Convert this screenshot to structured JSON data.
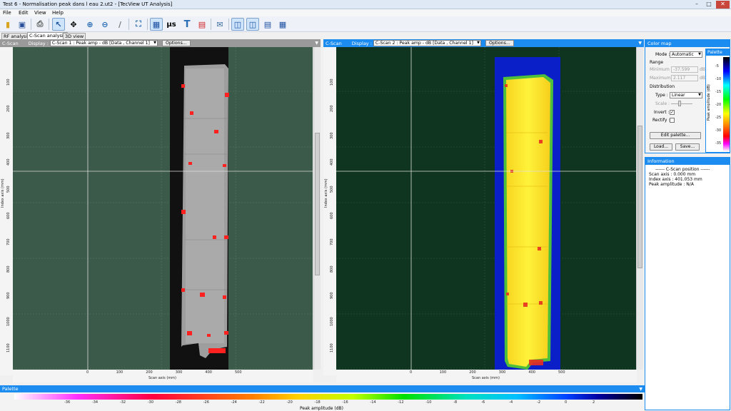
{
  "window": {
    "title": "Test 6 - Normalisation peak dans l eau 2.ut2 - [TecView UT Analysis]"
  },
  "menu": [
    "File",
    "Edit",
    "View",
    "Help"
  ],
  "toolbar": {
    "us_label": "µs",
    "t_label": "T"
  },
  "tabs": [
    "RF analysis",
    "C-Scan analysis",
    "3D view"
  ],
  "left_pane": {
    "label": "C-Scan",
    "display_label": "Display :",
    "display_value": "C-Scan 1 : Peak amp - dB [Data , Channel 1]",
    "options": "Options...",
    "y_axis_label": "Index axis (mm)",
    "x_axis_label": "Scan axis (mm)",
    "y_ticks": [
      "100",
      "200",
      "300",
      "400",
      "500",
      "600",
      "700",
      "800",
      "900",
      "1000",
      "1100"
    ],
    "x_ticks": [
      "0",
      "100",
      "200",
      "300",
      "400",
      "500"
    ]
  },
  "right_pane": {
    "label": "C-Scan",
    "display_label": "Display :",
    "display_value": "C-Scan 2 : Peak amp - dB [Data , Channel 1]",
    "options": "Options...",
    "y_axis_label": "Index axis (mm)",
    "x_axis_label": "Scan axis (mm)",
    "y_ticks": [
      "100",
      "200",
      "300",
      "400",
      "500",
      "600",
      "700",
      "800",
      "900",
      "1000",
      "1100"
    ],
    "x_ticks": [
      "0",
      "100",
      "200",
      "300",
      "400",
      "500"
    ]
  },
  "color_map": {
    "title": "Color map",
    "mode_label": "Mode :",
    "mode_value": "Automatic",
    "range_label": "Range",
    "minimum_label": "Minimum :",
    "minimum_value": "-37.599",
    "maximum_label": "Maximum :",
    "maximum_value": "2.117",
    "unit": "dB",
    "distribution_label": "Distribution",
    "type_label": "Type :",
    "type_value": "Linear",
    "scale_label": "Scale :",
    "invert_label": "Invert :",
    "invert_checked": true,
    "rectify_label": "Rectify :",
    "rectify_checked": false,
    "edit_palette": "Edit palette...",
    "load": "Load...",
    "save": "Save...",
    "palette_tab": "Palette",
    "palette_axis_label": "Peak amplitude (dB)",
    "palette_ticks": [
      "-5",
      "-10",
      "-15",
      "-20",
      "-25",
      "-30",
      "-35"
    ]
  },
  "information": {
    "title": "Information",
    "lines": [
      "------ C-Scan position ------",
      "Scan axis : 0.000 mm",
      "Index axis : 401.053 mm",
      "Peak amplitude : N/A"
    ]
  },
  "palette_bar": {
    "title": "Palette",
    "axis_label": "Peak amplitude (dB)",
    "ticks": [
      "-36",
      "-34",
      "-32",
      "-30",
      "-28",
      "-26",
      "-24",
      "-22",
      "-20",
      "-18",
      "-16",
      "-14",
      "-12",
      "-10",
      "-8",
      "-6",
      "-4",
      "-2",
      "0",
      "2"
    ]
  },
  "colors": {
    "accent": "#1d8cf0",
    "left_bg": "#3c5a4a",
    "right_bg": "#0f3520",
    "defect": "#ff2020"
  }
}
